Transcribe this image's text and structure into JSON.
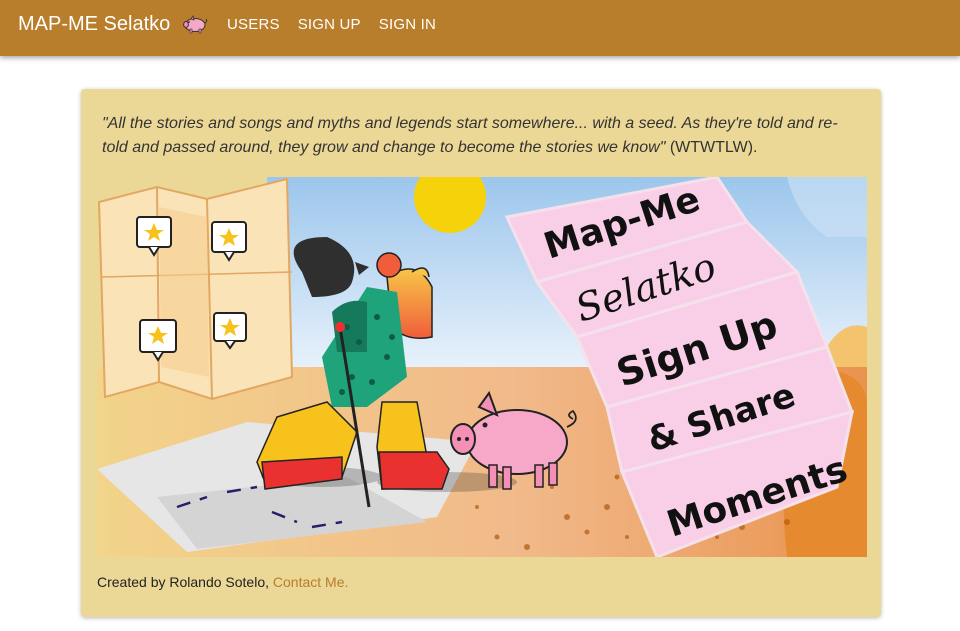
{
  "navbar": {
    "brand": "MAP-ME Selatko",
    "brand_icon": "pig-icon",
    "links": [
      "USERS",
      "SIGN UP",
      "SIGN IN"
    ]
  },
  "quote": {
    "text": "\"All the stories and songs and myths and legends start somewhere... with a seed. As they're told and re-told and passed around, they grow and change to become the stories we know\"",
    "source": " (WTWTLW)."
  },
  "hero": {
    "banner_lines": [
      "Map-Me",
      "Selatko",
      "Sign Up",
      "& Share",
      "Moments"
    ]
  },
  "footer": {
    "credit": "Created by Rolando Sotelo, ",
    "contact_label": "Contact Me."
  },
  "colors": {
    "navbar": "#b87e2c",
    "card": "#ecd896",
    "link": "#b87e2c",
    "banner": "#f9cfe8"
  }
}
